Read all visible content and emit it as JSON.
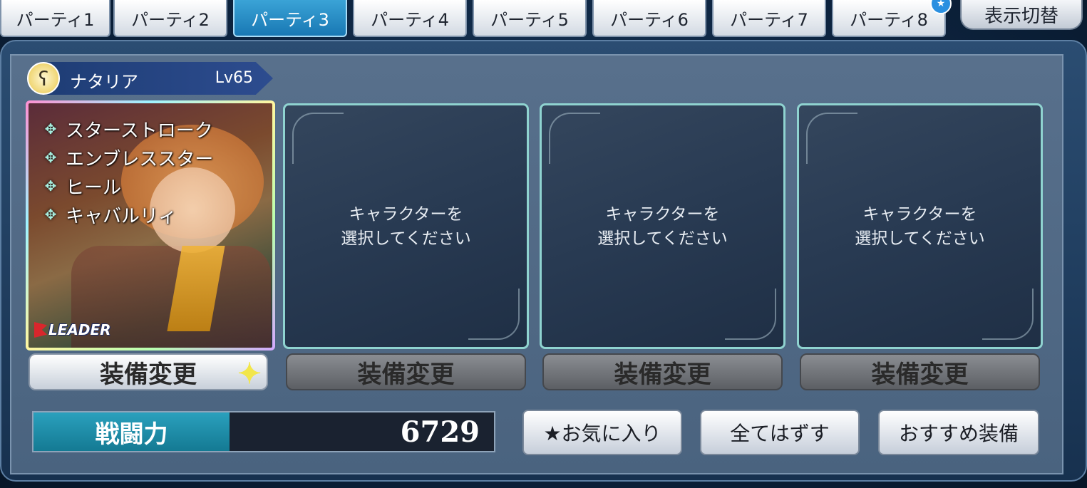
{
  "tabs": [
    {
      "label": "パーティ1",
      "active": false
    },
    {
      "label": "パーティ2",
      "active": false
    },
    {
      "label": "パーティ3",
      "active": true
    },
    {
      "label": "パーティ4",
      "active": false
    },
    {
      "label": "パーティ5",
      "active": false
    },
    {
      "label": "パーティ6",
      "active": false
    },
    {
      "label": "パーティ7",
      "active": false
    },
    {
      "label": "パーティ8",
      "active": false
    }
  ],
  "tab_badge": "★",
  "toggle_label": "表示切替",
  "leader": {
    "name": "ナタリア",
    "level": "Lv65",
    "badge": "LEADER",
    "skills": [
      "スターストローク",
      "エンブレススター",
      "ヒール",
      "キャバルリィ"
    ]
  },
  "empty_slot_text": "キャラクターを\n選択してください",
  "slots": [
    {
      "text": "キャラクターを\n選択してください"
    },
    {
      "text": "キャラクターを\n選択してください"
    },
    {
      "text": "キャラクターを\n選択してください"
    }
  ],
  "equip_label": "装備変更",
  "power": {
    "label": "戦闘力",
    "value": "6729"
  },
  "actions": {
    "favorite": "★お気に入り",
    "remove_all": "全てはずす",
    "recommended": "おすすめ装備"
  },
  "colors": {
    "active_tab": "#1978b4",
    "slot_border": "#8fd3d0",
    "power_label_bg": "#147a93"
  }
}
